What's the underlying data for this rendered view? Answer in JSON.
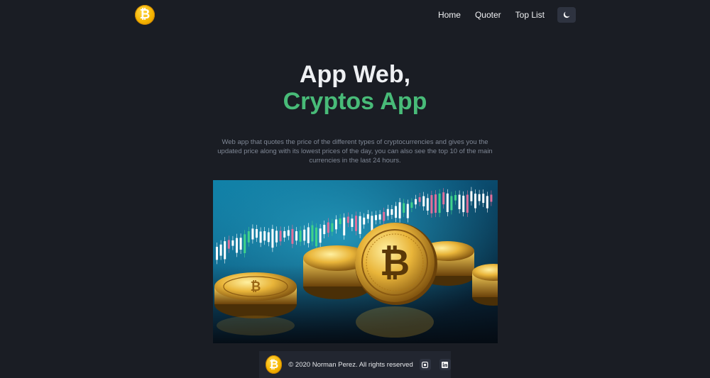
{
  "navbar": {
    "logo_icon": "bitcoin-logo-icon",
    "links": [
      {
        "label": "Home"
      },
      {
        "label": "Quoter"
      },
      {
        "label": "Top List"
      }
    ],
    "theme_toggle_icon": "moon-icon"
  },
  "hero": {
    "title_line1": "App Web,",
    "title_line2": "Cryptos App",
    "description": "Web app that quotes the price of the different types of cryptocurrencies and gives you the updated price along with its lowest prices of the day, you can also see the top 10 of the main currencies in the last 24 hours.",
    "image_alt": "bitcoin coins with candlestick chart"
  },
  "footer": {
    "logo_icon": "bitcoin-logo-icon",
    "copyright": "© 2020 Norman Perez. All rights reserved",
    "social": [
      {
        "icon": "github-icon"
      },
      {
        "icon": "linkedin-icon"
      }
    ]
  },
  "colors": {
    "background": "#1a1d24",
    "accent_green": "#48bb78",
    "bitcoin_gold": "#f5b400"
  }
}
